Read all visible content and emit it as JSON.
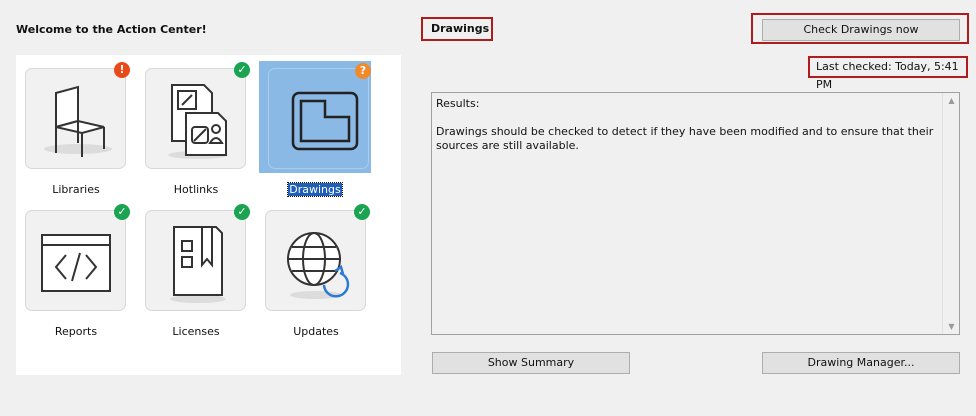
{
  "welcome": "Welcome to the Action Center!",
  "tiles": [
    {
      "label": "Libraries",
      "icon": "chair-icon",
      "status": "warning",
      "badge": "!"
    },
    {
      "label": "Hotlinks",
      "icon": "hotlinks-document-icon",
      "status": "ok",
      "badge": "✓"
    },
    {
      "label": "Drawings",
      "icon": "drawing-icon",
      "status": "unknown",
      "badge": "?",
      "selected": true
    },
    {
      "label": "Reports",
      "icon": "code-report-icon",
      "status": "ok",
      "badge": "✓"
    },
    {
      "label": "Licenses",
      "icon": "license-book-icon",
      "status": "ok",
      "badge": "✓"
    },
    {
      "label": "Updates",
      "icon": "globe-update-icon",
      "status": "ok",
      "badge": "✓"
    }
  ],
  "section_title": "Drawings",
  "check_button": "Check Drawings now",
  "last_checked": "Last checked: Today, 5:41 PM",
  "results": {
    "heading": "Results:",
    "body": "Drawings should be checked to detect if they have been modified and to ensure that their sources are still available."
  },
  "show_summary_button": "Show Summary",
  "drawing_manager_button": "Drawing Manager...",
  "colors": {
    "ok": "#1aa350",
    "warning": "#ea4a1a",
    "unknown": "#f08a2a",
    "highlight_outline": "#b01c1c",
    "selection": "#8ab9e6"
  }
}
